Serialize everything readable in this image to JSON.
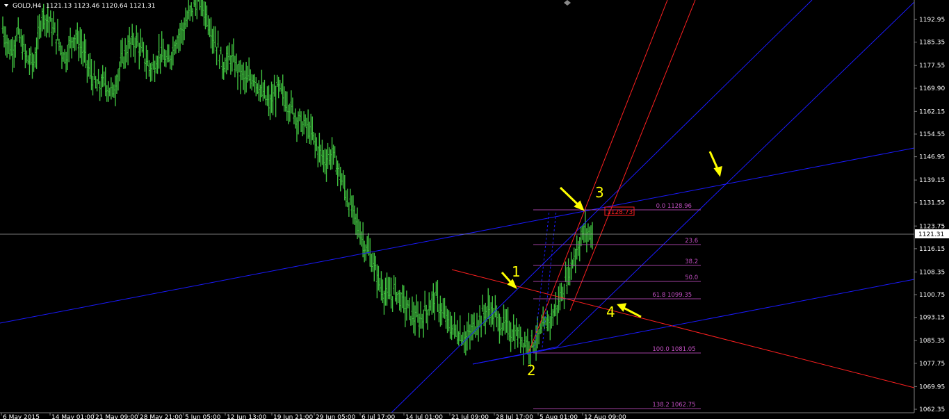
{
  "symbol": "GOLD,H4",
  "header_values": "1121.13 1123.46 1120.64 1121.31",
  "current_price_label": "1121.31",
  "price_box_label": "1128.73",
  "colors": {
    "background": "#000000",
    "candles": "#3fbf3f",
    "trendline_blue": "#1a1aff",
    "trendline_red": "#ff2020",
    "fib": "#a040a0",
    "annotation": "#ffff00",
    "axis_text": "#ffffff"
  },
  "price_axis": [
    "1192.95",
    "1185.35",
    "1177.55",
    "1169.90",
    "1162.15",
    "1154.55",
    "1146.95",
    "1139.15",
    "1131.55",
    "1123.75",
    "1116.15",
    "1108.35",
    "1100.75",
    "1093.15",
    "1085.35",
    "1077.75",
    "1069.95",
    "1062.35"
  ],
  "time_axis": [
    "6 May 2015",
    "14 May 01:00",
    "21 May 09:00",
    "28 May 21:00",
    "5 Jun 05:00",
    "12 Jun 13:00",
    "19 Jun 21:00",
    "29 Jun 05:00",
    "6 Jul 17:00",
    "14 Jul 01:00",
    "21 Jul 09:00",
    "28 Jul 17:00",
    "5 Aug 01:00",
    "12 Aug 09:00"
  ],
  "fib_levels": [
    {
      "label": "0.0  1128.96"
    },
    {
      "label": "23.6"
    },
    {
      "label": "38.2"
    },
    {
      "label": "50.0"
    },
    {
      "label": "61.8  1099.35"
    },
    {
      "label": "100.0 1081.05"
    },
    {
      "label": "138.2 1062.75"
    }
  ],
  "annotations": [
    "1",
    "2",
    "3",
    "4"
  ],
  "chart_data": {
    "type": "candlestick",
    "title": "GOLD,H4",
    "ylim": [
      1059,
      1199
    ],
    "close_path": [
      1190,
      1182,
      1188,
      1180,
      1178,
      1195,
      1192,
      1186,
      1180,
      1188,
      1184,
      1176,
      1170,
      1172,
      1168,
      1178,
      1184,
      1186,
      1180,
      1176,
      1182,
      1178,
      1186,
      1190,
      1196,
      1200,
      1194,
      1186,
      1178,
      1180,
      1176,
      1172,
      1174,
      1168,
      1164,
      1170,
      1166,
      1162,
      1158,
      1156,
      1150,
      1146,
      1148,
      1140,
      1132,
      1125,
      1118,
      1112,
      1104,
      1100,
      1102,
      1098,
      1094,
      1092,
      1096,
      1100,
      1094,
      1090,
      1088,
      1086,
      1090,
      1094,
      1096,
      1092,
      1090,
      1088,
      1086,
      1084,
      1086,
      1090,
      1094,
      1100,
      1108,
      1116,
      1122,
      1121
    ],
    "fib_levels": [
      1128.96,
      1117.4,
      1110.3,
      1105.0,
      1099.35,
      1081.05,
      1062.75
    ],
    "current_price": 1121.31
  }
}
